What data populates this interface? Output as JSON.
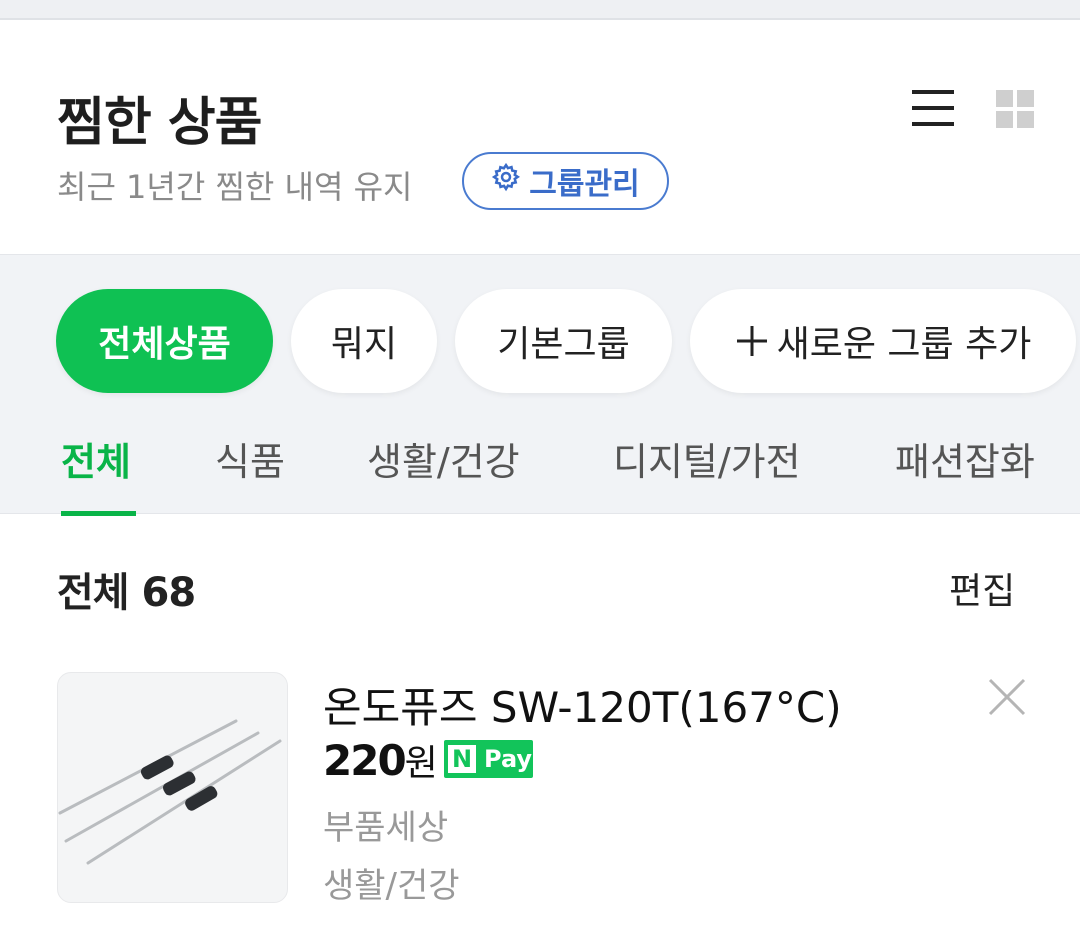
{
  "header": {
    "title": "찜한 상품",
    "subtitle": "최근 1년간 찜한 내역 유지",
    "group_manage_label": "그룹관리",
    "icons": [
      "list-view-icon",
      "grid-view-icon",
      "gear-icon"
    ]
  },
  "groups": [
    {
      "label": "전체상품",
      "active": true
    },
    {
      "label": "뭐지",
      "active": false
    },
    {
      "label": "기본그룹",
      "active": false
    },
    {
      "label": "새로운 그룹 추가",
      "active": false
    }
  ],
  "category_tabs": [
    {
      "label": "전체",
      "active": true
    },
    {
      "label": "식품",
      "active": false
    },
    {
      "label": "생활/건강",
      "active": false
    },
    {
      "label": "디지털/가전",
      "active": false
    },
    {
      "label": "패션잡화",
      "active": false
    }
  ],
  "list": {
    "count_label": "전체 68",
    "edit_label": "편집"
  },
  "products": [
    {
      "name": "온도퓨즈 SW-120T(167°C)",
      "price": "220",
      "currency": "원",
      "npay_n": "N",
      "npay_label": "Pay",
      "store": "부품세상",
      "category": "생활/건강"
    }
  ],
  "colors": {
    "accent_green": "#0fc153",
    "accent_blue": "#3a6cc9",
    "filter_bg": "#f1f3f6"
  }
}
